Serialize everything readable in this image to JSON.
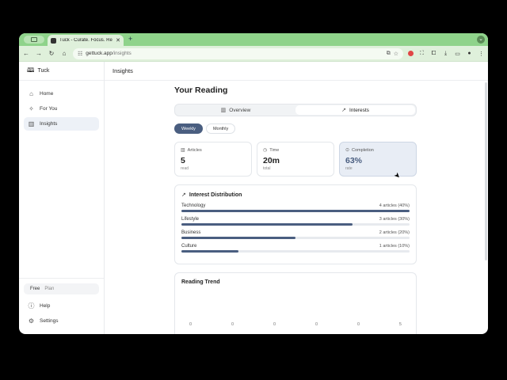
{
  "browser": {
    "tab_title": "Tuck - Curate. Focus. Remem",
    "url": "gettuck.app/insights",
    "url_host": "gettuck.app",
    "url_path": "/insights"
  },
  "sidebar": {
    "brand": "Tuck",
    "items": [
      {
        "label": "Home",
        "icon": "home-icon"
      },
      {
        "label": "For You",
        "icon": "sparkles-icon"
      },
      {
        "label": "Insights",
        "icon": "chart-icon",
        "active": true
      }
    ],
    "plan": {
      "name": "Free",
      "suffix": "Plan"
    },
    "footer": [
      {
        "label": "Help",
        "icon": "help-icon"
      },
      {
        "label": "Settings",
        "icon": "gear-icon"
      }
    ]
  },
  "header": {
    "title": "Insights"
  },
  "page": {
    "title": "Your Reading",
    "tabs": [
      {
        "label": "Overview",
        "active": false
      },
      {
        "label": "Interests",
        "active": true
      }
    ],
    "period": [
      {
        "label": "Weekly",
        "active": true
      },
      {
        "label": "Monthly",
        "active": false
      }
    ],
    "stats": [
      {
        "label": "Articles",
        "value": "5",
        "sub": "read"
      },
      {
        "label": "Time",
        "value": "20m",
        "sub": "total"
      },
      {
        "label": "Completion",
        "value": "63%",
        "sub": "rate"
      }
    ],
    "distribution": {
      "title": "Interest Distribution",
      "items": [
        {
          "name": "Technology",
          "count": "4 articles (40%)",
          "fraction": 1.0
        },
        {
          "name": "Lifestyle",
          "count": "3 articles (30%)",
          "fraction": 0.75
        },
        {
          "name": "Business",
          "count": "2 articles (20%)",
          "fraction": 0.5
        },
        {
          "name": "Culture",
          "count": "1 articles (10%)",
          "fraction": 0.25
        }
      ]
    },
    "trend": {
      "title": "Reading Trend",
      "ticks": [
        "0",
        "0",
        "0",
        "0",
        "0",
        "5"
      ]
    }
  },
  "colors": {
    "accent": "#4a5e80",
    "chrome": "#8fd38b"
  }
}
